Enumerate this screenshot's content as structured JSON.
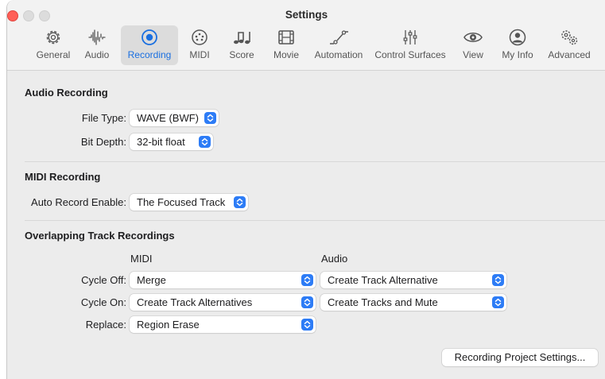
{
  "window": {
    "title": "Settings"
  },
  "tabs": [
    {
      "label": "General",
      "icon": "gear-icon",
      "active": false
    },
    {
      "label": "Audio",
      "icon": "waveform-icon",
      "active": false
    },
    {
      "label": "Recording",
      "icon": "record-icon",
      "active": true
    },
    {
      "label": "MIDI",
      "icon": "palette-icon",
      "active": false
    },
    {
      "label": "Score",
      "icon": "music-notes-icon",
      "active": false
    },
    {
      "label": "Movie",
      "icon": "film-icon",
      "active": false
    },
    {
      "label": "Automation",
      "icon": "automation-curve-icon",
      "active": false
    },
    {
      "label": "Control Surfaces",
      "icon": "sliders-icon",
      "active": false
    },
    {
      "label": "View",
      "icon": "eye-icon",
      "active": false
    },
    {
      "label": "My Info",
      "icon": "person-icon",
      "active": false
    },
    {
      "label": "Advanced",
      "icon": "gears-icon",
      "active": false
    }
  ],
  "audio_recording": {
    "heading": "Audio Recording",
    "file_type_label": "File Type:",
    "file_type_value": "WAVE (BWF)",
    "bit_depth_label": "Bit Depth:",
    "bit_depth_value": "32-bit float"
  },
  "midi_recording": {
    "heading": "MIDI Recording",
    "auto_record_label": "Auto Record Enable:",
    "auto_record_value": "The Focused Track"
  },
  "overlapping": {
    "heading": "Overlapping Track Recordings",
    "col_midi": "MIDI",
    "col_audio": "Audio",
    "rows": [
      {
        "label": "Cycle Off:",
        "midi": "Merge",
        "audio": "Create Track Alternative"
      },
      {
        "label": "Cycle On:",
        "midi": "Create Track Alternatives",
        "audio": "Create Tracks and Mute"
      },
      {
        "label": "Replace:",
        "midi": "Region Erase",
        "audio": ""
      }
    ]
  },
  "footer": {
    "project_settings_button": "Recording Project Settings..."
  },
  "colors": {
    "accent": "#2d7cf6",
    "active_tab_text": "#1a6fe0",
    "close": "#ff5f57"
  }
}
